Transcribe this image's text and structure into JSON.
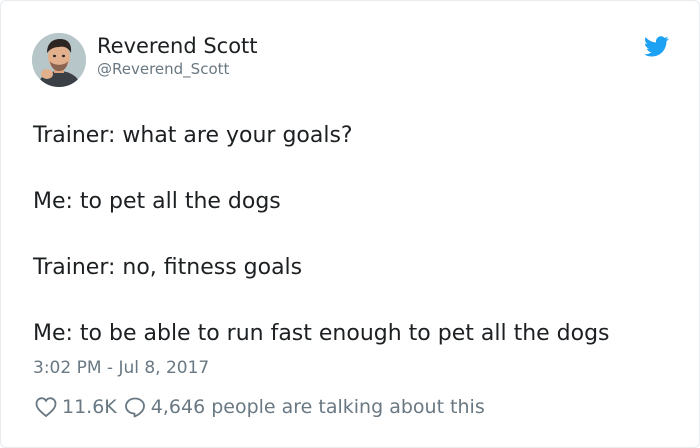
{
  "user": {
    "display_name": "Reverend Scott",
    "handle": "@Reverend_Scott",
    "avatar_icon": "user-avatar-photo"
  },
  "brand": {
    "icon": "twitter-bird-icon",
    "color": "#1da1f2"
  },
  "tweet": {
    "lines": [
      "Trainer: what are your goals?",
      "Me: to pet all the dogs",
      "Trainer: no, fitness goals",
      "Me: to be able to run fast enough to pet all the dogs"
    ],
    "timestamp": "3:02 PM - Jul 8, 2017"
  },
  "actions": {
    "like_icon": "heart-icon",
    "likes": "11.6K",
    "reply_icon": "speech-bubble-icon",
    "talking": "4,646 people are talking about this"
  },
  "colors": {
    "text": "#1c2022",
    "secondary": "#697882",
    "border": "#e6ecf0"
  }
}
